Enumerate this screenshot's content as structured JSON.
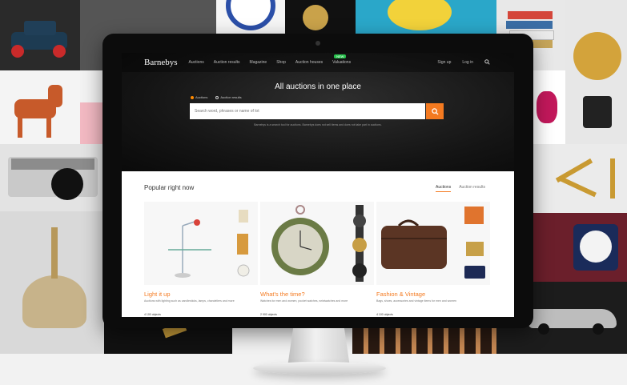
{
  "site": {
    "logo": "Barnebys",
    "nav": [
      "Auctions",
      "Auction results",
      "Magazine",
      "Shop",
      "Auction houses",
      "Valuations"
    ],
    "new_badge": "NEW",
    "right_nav": [
      "Sign up",
      "Log in"
    ]
  },
  "hero": {
    "title": "All auctions in one place",
    "radio_options": [
      "Auctions",
      "Auction results"
    ],
    "search_placeholder": "Search word, phrases or name of lot",
    "disclaimer": "Barnebys is a search tool for auctions. Barnebys does not sell items and does not take part in auctions."
  },
  "popular": {
    "title": "Popular right now",
    "tabs": [
      "Auctions",
      "Auction results"
    ],
    "cards": [
      {
        "title": "Light it up",
        "desc": "Auctions with lighting such as candlesticks, lamps, chandeliers and more",
        "count": "4 100 objects"
      },
      {
        "title": "What's the time?",
        "desc": "Watches for men and women, pocket watches, wristwatches and more",
        "count": "2 900 objects"
      },
      {
        "title": "Fashion & Vintage",
        "desc": "Bags, shoes, accessories and vintage items for men and women",
        "count": "4 100 objects"
      }
    ]
  },
  "colors": {
    "accent": "#f47a20",
    "badge": "#27c24c"
  }
}
